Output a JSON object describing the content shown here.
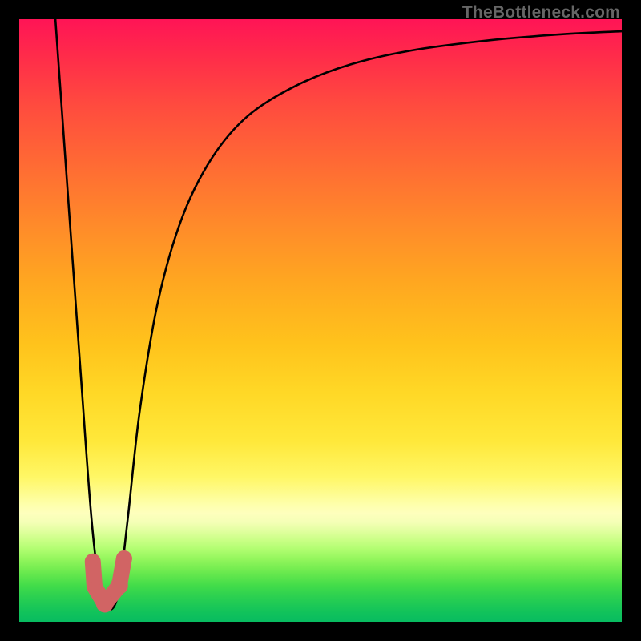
{
  "attribution": "TheBottleneck.com",
  "chart_data": {
    "type": "line",
    "title": "",
    "xlabel": "",
    "ylabel": "",
    "xlim": [
      0,
      100
    ],
    "ylim": [
      0,
      100
    ],
    "series": [
      {
        "name": "bottleneck-curve",
        "x": [
          6,
          10,
          12,
          13.5,
          15,
          16.5,
          18,
          20,
          23,
          27,
          32,
          38,
          46,
          55,
          65,
          78,
          90,
          100
        ],
        "values": [
          100,
          44,
          17,
          5,
          2,
          5,
          17,
          35,
          53,
          67,
          77,
          84,
          89,
          92.5,
          94.8,
          96.5,
          97.5,
          98
        ]
      }
    ],
    "markers": [
      {
        "name": "j-marker-top-dot",
        "x_pct": 12.2,
        "y_pct_from_bottom": 10.0,
        "r": 6,
        "color": "#d16464"
      },
      {
        "name": "j-marker-mid-dot",
        "x_pct": 12.5,
        "y_pct_from_bottom": 5.8,
        "r": 7,
        "color": "#d16464"
      },
      {
        "name": "j-marker-base-blob",
        "x_pct": 14.2,
        "y_pct_from_bottom": 3.0,
        "r": 11,
        "color": "#d16464"
      },
      {
        "name": "j-marker-hook-blob",
        "x_pct": 16.6,
        "y_pct_from_bottom": 6.0,
        "r": 11,
        "color": "#d16464"
      },
      {
        "name": "j-marker-tip-blob",
        "x_pct": 17.4,
        "y_pct_from_bottom": 10.5,
        "r": 10,
        "color": "#d16464"
      }
    ]
  }
}
